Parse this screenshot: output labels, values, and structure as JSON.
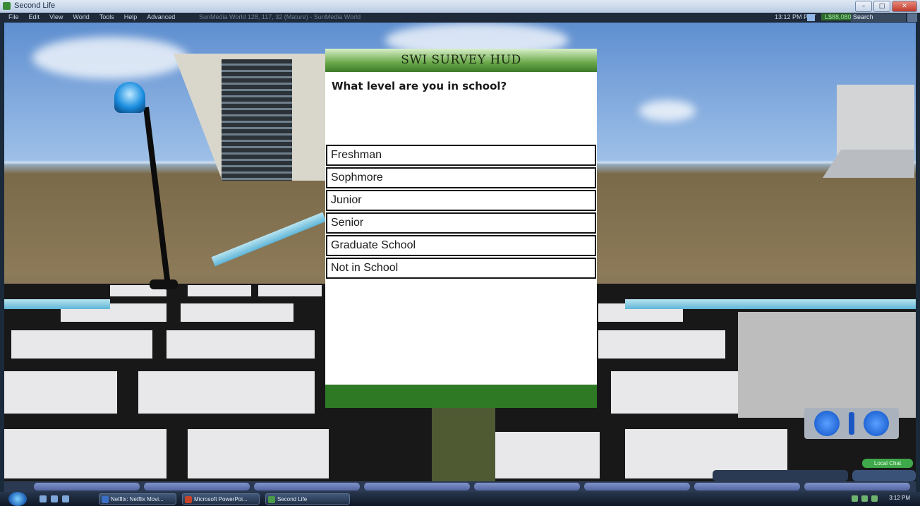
{
  "window": {
    "title": "Second Life",
    "controls": [
      "–",
      "□",
      "✕"
    ]
  },
  "menubar": {
    "items": [
      "File",
      "Edit",
      "View",
      "World",
      "Tools",
      "Help",
      "Advanced"
    ],
    "location": "SunMedia World 128, 117, 32 (Mature) - SunMedia World",
    "time": "13:12 PM PST",
    "balance": "L$88,080",
    "search_placeholder": "Search"
  },
  "hud": {
    "title": "SWI SURVEY HUD",
    "question": "What level are you in school?",
    "options": [
      "Freshman",
      "Sophmore",
      "Junior",
      "Senior",
      "Graduate School",
      "Not in School"
    ],
    "header_color": "#5a9a3a",
    "footer_color": "#2e7a24"
  },
  "chat": {
    "local_chat_label": "Local Chat"
  },
  "taskbar": {
    "items": [
      {
        "label": "Netflix: Netflix Movi...",
        "icon": "netflix-icon",
        "color": "#3a6fc4"
      },
      {
        "label": "Microsoft PowerPoi...",
        "icon": "powerpoint-icon",
        "color": "#c4442a"
      },
      {
        "label": "Second Life",
        "icon": "secondlife-icon",
        "color": "#4a9a4a"
      }
    ],
    "clock": "3:12 PM"
  }
}
